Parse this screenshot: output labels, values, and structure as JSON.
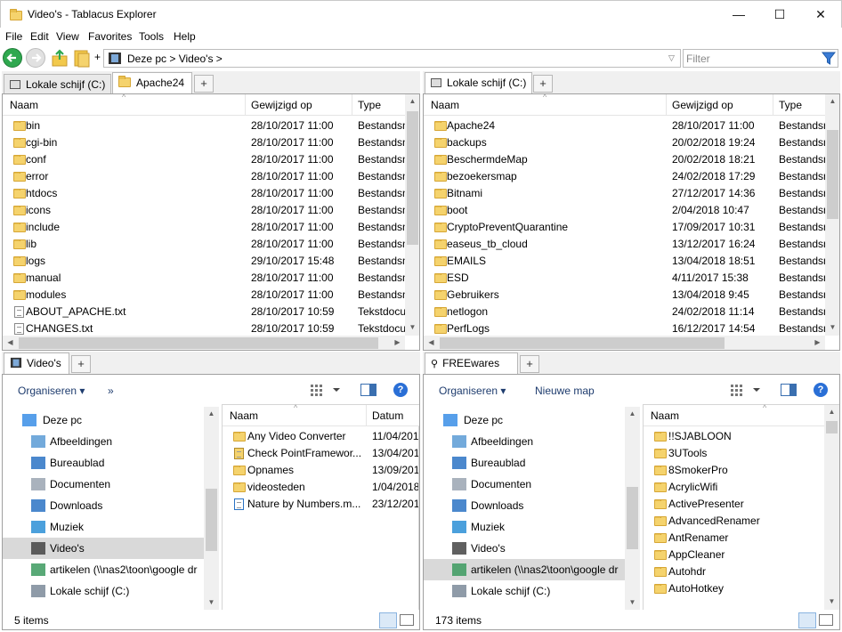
{
  "window": {
    "title": "Video's - Tablacus Explorer",
    "min": "—",
    "max": "☐",
    "close": "✕"
  },
  "menu": [
    "File",
    "Edit",
    "View",
    "Favorites",
    "Tools",
    "Help"
  ],
  "toolbar": {
    "plus": "+",
    "address_path": "Deze pc > Video's >",
    "filter_placeholder": "Filter"
  },
  "top_left": {
    "tabs": [
      "Lokale schijf (C:)",
      "Apache24"
    ],
    "add": "+",
    "headers": [
      "Naam",
      "Gewijzigd op",
      "Type"
    ],
    "rows": [
      {
        "name": "bin",
        "date": "28/10/2017 11:00",
        "type": "Bestandsm",
        "kind": "folder"
      },
      {
        "name": "cgi-bin",
        "date": "28/10/2017 11:00",
        "type": "Bestandsm",
        "kind": "folder"
      },
      {
        "name": "conf",
        "date": "28/10/2017 11:00",
        "type": "Bestandsm",
        "kind": "folder"
      },
      {
        "name": "error",
        "date": "28/10/2017 11:00",
        "type": "Bestandsm",
        "kind": "folder"
      },
      {
        "name": "htdocs",
        "date": "28/10/2017 11:00",
        "type": "Bestandsm",
        "kind": "folder"
      },
      {
        "name": "icons",
        "date": "28/10/2017 11:00",
        "type": "Bestandsm",
        "kind": "folder"
      },
      {
        "name": "include",
        "date": "28/10/2017 11:00",
        "type": "Bestandsm",
        "kind": "folder"
      },
      {
        "name": "lib",
        "date": "28/10/2017 11:00",
        "type": "Bestandsm",
        "kind": "folder"
      },
      {
        "name": "logs",
        "date": "29/10/2017 15:48",
        "type": "Bestandsm",
        "kind": "folder"
      },
      {
        "name": "manual",
        "date": "28/10/2017 11:00",
        "type": "Bestandsm",
        "kind": "folder"
      },
      {
        "name": "modules",
        "date": "28/10/2017 11:00",
        "type": "Bestandsm",
        "kind": "folder"
      },
      {
        "name": "ABOUT_APACHE.txt",
        "date": "28/10/2017 10:59",
        "type": "Tekstdocu",
        "kind": "txt"
      },
      {
        "name": "CHANGES.txt",
        "date": "28/10/2017 10:59",
        "type": "Tekstdocu",
        "kind": "txt"
      }
    ]
  },
  "top_right": {
    "tabs": [
      "Lokale schijf (C:)"
    ],
    "add": "+",
    "headers": [
      "Naam",
      "Gewijzigd op",
      "Type"
    ],
    "rows": [
      {
        "name": "Apache24",
        "date": "28/10/2017 11:00",
        "type": "Bestandsm"
      },
      {
        "name": "backups",
        "date": "20/02/2018 19:24",
        "type": "Bestandsm"
      },
      {
        "name": "BeschermdeMap",
        "date": "20/02/2018 18:21",
        "type": "Bestandsm"
      },
      {
        "name": "bezoekersmap",
        "date": "24/02/2018 17:29",
        "type": "Bestandsm"
      },
      {
        "name": "Bitnami",
        "date": "27/12/2017 14:36",
        "type": "Bestandsm"
      },
      {
        "name": "boot",
        "date": "2/04/2018 10:47",
        "type": "Bestandsm"
      },
      {
        "name": "CryptoPreventQuarantine",
        "date": "17/09/2017 10:31",
        "type": "Bestandsm"
      },
      {
        "name": "easeus_tb_cloud",
        "date": "13/12/2017 16:24",
        "type": "Bestandsm"
      },
      {
        "name": "EMAILS",
        "date": "13/04/2018 18:51",
        "type": "Bestandsm"
      },
      {
        "name": "ESD",
        "date": "4/11/2017 15:38",
        "type": "Bestandsm"
      },
      {
        "name": "Gebruikers",
        "date": "13/04/2018 9:45",
        "type": "Bestandsm"
      },
      {
        "name": "netlogon",
        "date": "24/02/2018 11:14",
        "type": "Bestandsm"
      },
      {
        "name": "PerfLogs",
        "date": "16/12/2017 14:54",
        "type": "Bestandsm"
      }
    ]
  },
  "bottom_left": {
    "tabs": [
      "Video's"
    ],
    "add": "+",
    "cmd": {
      "organise": "Organiseren ▾",
      "more": "»",
      "help": "?"
    },
    "nav": [
      {
        "label": "Deze pc",
        "icon": "monitor-icon"
      },
      {
        "label": "Afbeeldingen",
        "icon": "pictures-icon"
      },
      {
        "label": "Bureaublad",
        "icon": "desktop-icon"
      },
      {
        "label": "Documenten",
        "icon": "documents-icon"
      },
      {
        "label": "Downloads",
        "icon": "downloads-icon"
      },
      {
        "label": "Muziek",
        "icon": "music-icon"
      },
      {
        "label": "Video's",
        "icon": "videos-icon"
      },
      {
        "label": "artikelen (\\\\nas2\\toon\\google dr",
        "icon": "network-drive-icon"
      },
      {
        "label": "Lokale schijf (C:)",
        "icon": "local-disk-icon"
      }
    ],
    "headers": [
      "Naam",
      "Datum"
    ],
    "files": [
      {
        "name": "Any Video Converter",
        "date": "11/04/201",
        "kind": "folder"
      },
      {
        "name": "Check PointFramewor...",
        "date": "13/04/201",
        "kind": "lock"
      },
      {
        "name": "Opnames",
        "date": "13/09/201",
        "kind": "folder"
      },
      {
        "name": "videosteden",
        "date": "1/04/2018",
        "kind": "folder"
      },
      {
        "name": "Nature by Numbers.m...",
        "date": "23/12/201",
        "kind": "video"
      }
    ],
    "status": "5 items"
  },
  "bottom_right": {
    "tabs": [
      "FREEwares"
    ],
    "add": "+",
    "cmd": {
      "organise": "Organiseren ▾",
      "newfolder": "Nieuwe map",
      "help": "?"
    },
    "nav": [
      {
        "label": "Deze pc",
        "icon": "monitor-icon"
      },
      {
        "label": "Afbeeldingen",
        "icon": "pictures-icon"
      },
      {
        "label": "Bureaublad",
        "icon": "desktop-icon"
      },
      {
        "label": "Documenten",
        "icon": "documents-icon"
      },
      {
        "label": "Downloads",
        "icon": "downloads-icon"
      },
      {
        "label": "Muziek",
        "icon": "music-icon"
      },
      {
        "label": "Video's",
        "icon": "videos-icon"
      },
      {
        "label": "artikelen (\\\\nas2\\toon\\google dr",
        "icon": "network-drive-icon"
      },
      {
        "label": "Lokale schijf (C:)",
        "icon": "local-disk-icon"
      }
    ],
    "headers": [
      "Naam"
    ],
    "files": [
      "!!SJABLOON",
      "3UTools",
      "8SmokerPro",
      "AcrylicWifi",
      "ActivePresenter",
      "AdvancedRenamer",
      "AntRenamer",
      "AppCleaner",
      "Autohdr",
      "AutoHotkey"
    ],
    "status": "173 items"
  }
}
